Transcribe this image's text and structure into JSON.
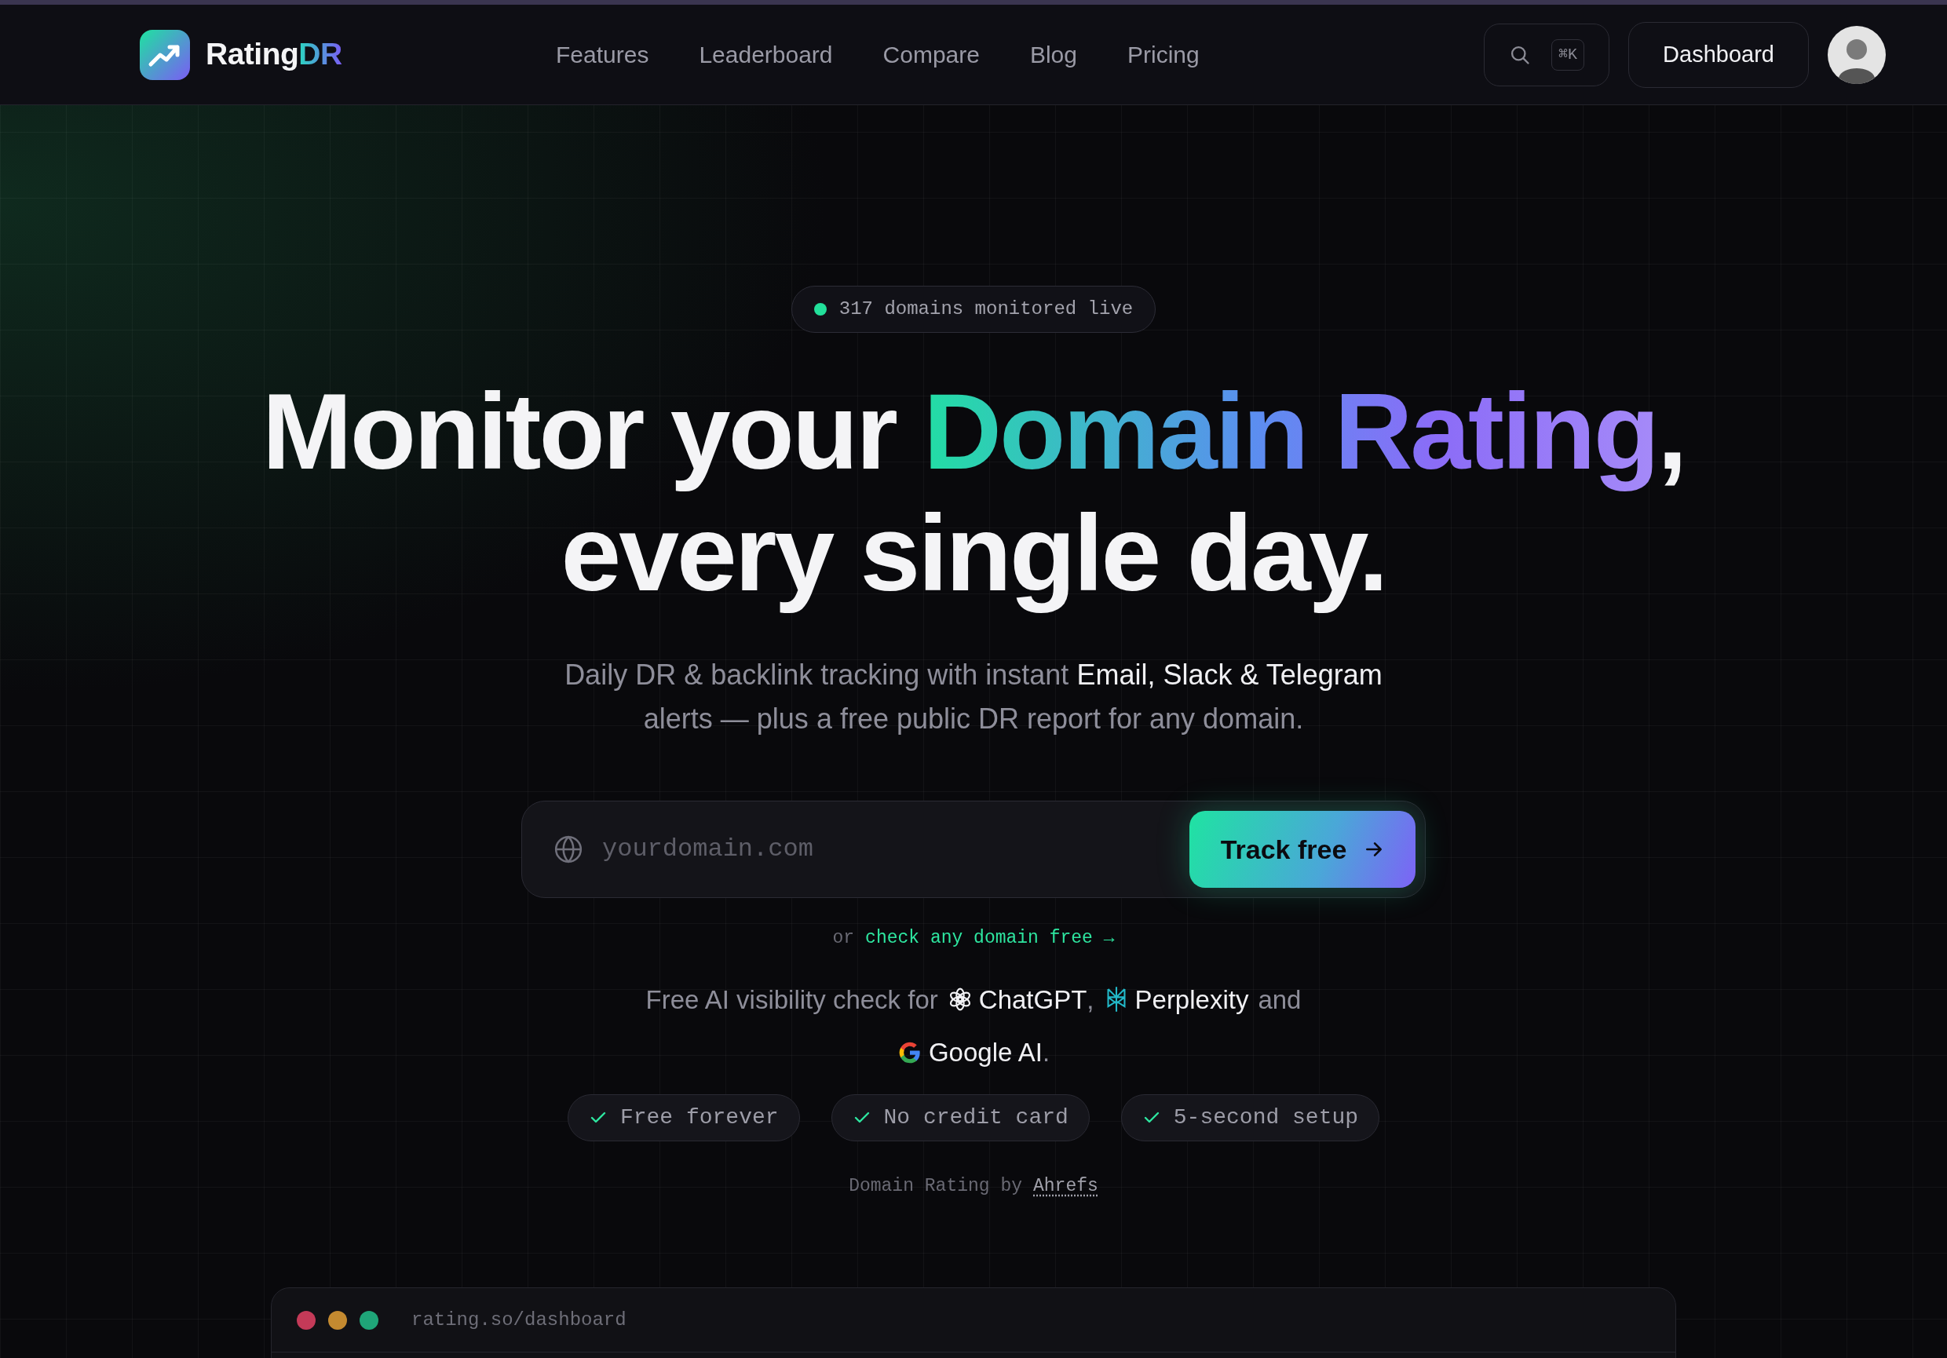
{
  "nav": {
    "logo": {
      "name": "Rating",
      "accent": "DR"
    },
    "links": [
      "Features",
      "Leaderboard",
      "Compare",
      "Blog",
      "Pricing"
    ],
    "search": {
      "shortcut": "⌘K"
    },
    "dashboard_button": "Dashboard"
  },
  "hero": {
    "badge": {
      "text": "317 domains monitored live",
      "color": "#22e09a"
    },
    "headline": [
      [
        {
          "text": "Monitor your ",
          "kind": "plain"
        },
        {
          "text": "Domain Rating",
          "kind": "gradient"
        },
        {
          "text": ",",
          "kind": "plain"
        }
      ],
      [
        {
          "text": "every single day.",
          "kind": "plain"
        }
      ]
    ],
    "subtitle": [
      [
        {
          "text": "Daily DR & backlink tracking with instant ",
          "highlight": false
        },
        {
          "text": "Email, Slack & Telegram",
          "highlight": true
        }
      ],
      [
        {
          "text": "alerts — plus a free public DR report for any domain.",
          "highlight": false
        }
      ]
    ],
    "form": {
      "placeholder": "yourdomain.com",
      "button": "Track free"
    },
    "alt_link": {
      "prefix": "or",
      "link": "check any domain free →"
    },
    "ai_line": [
      [
        {
          "text": "Free AI visibility check for",
          "kind": "text"
        },
        {
          "text": "ChatGPT",
          "kind": "chatgpt"
        },
        {
          "text": ",",
          "kind": "text"
        },
        {
          "text": "Perplexity",
          "kind": "perplexity"
        },
        {
          "text": "and",
          "kind": "text"
        }
      ],
      [
        {
          "text": "Google AI",
          "kind": "google"
        },
        {
          "text": ".",
          "kind": "text"
        }
      ]
    ],
    "chips": [
      "Free forever",
      "No credit card",
      "5-second setup"
    ],
    "credit": {
      "text": "Domain Rating by",
      "link": "Ahrefs"
    }
  },
  "preview": {
    "dots": [
      {
        "color": "#c43a58"
      },
      {
        "color": "#c48a30"
      },
      {
        "color": "#1fa578"
      }
    ],
    "url": "rating.so/dashboard"
  }
}
